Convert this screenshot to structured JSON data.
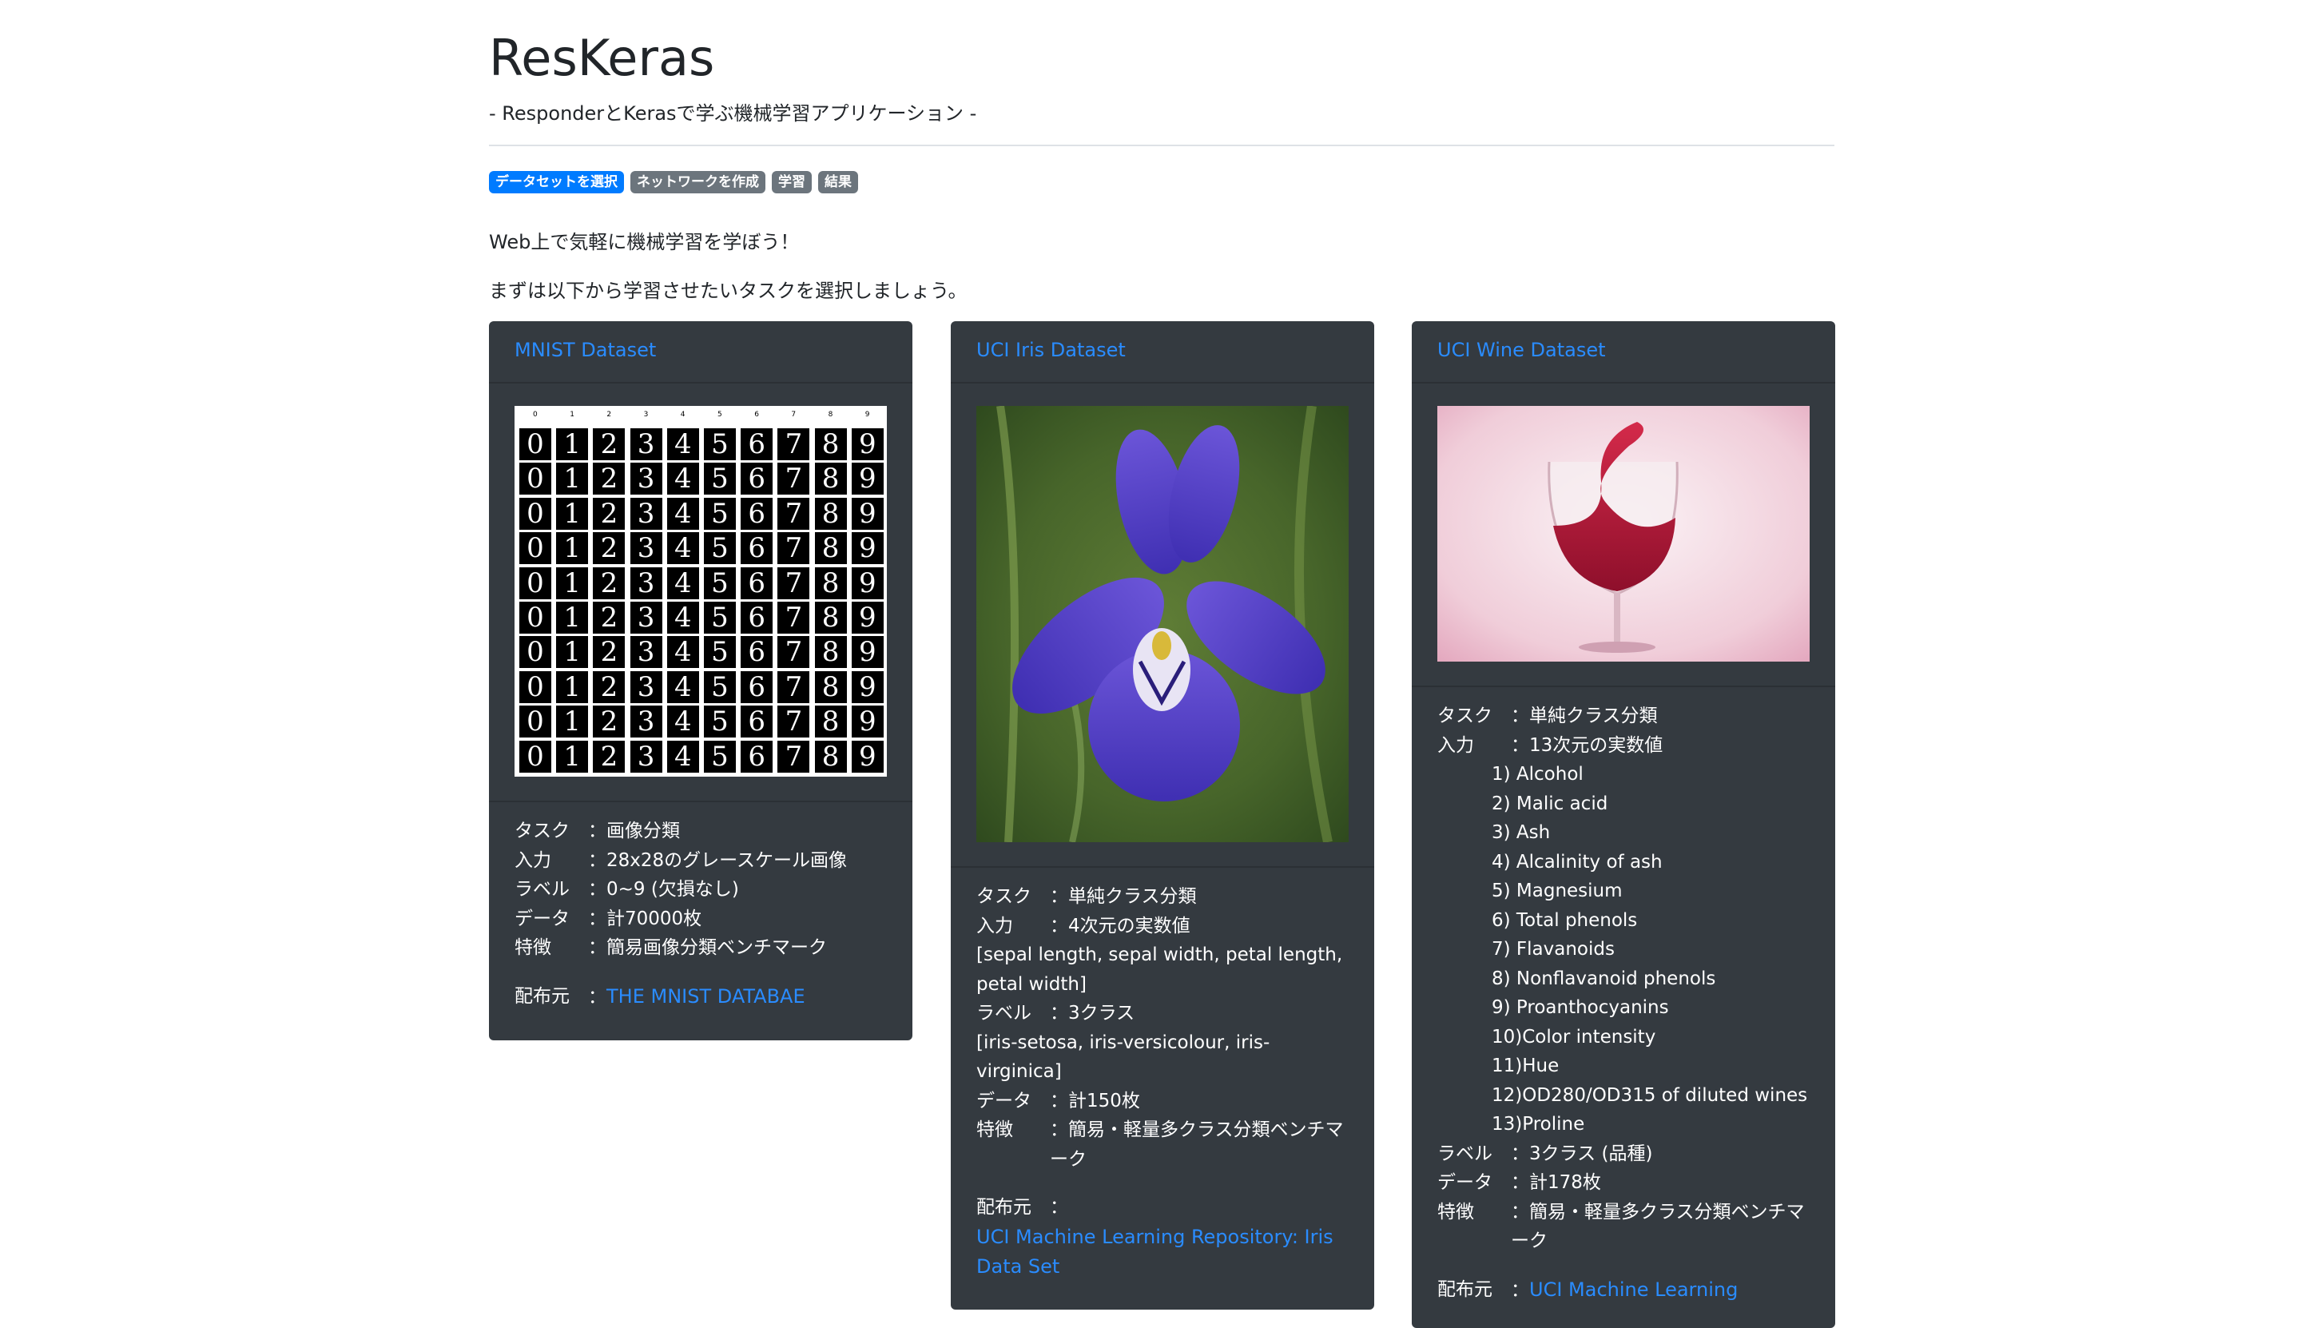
{
  "header": {
    "title": "ResKeras",
    "subtitle": "- ResponderとKerasで学ぶ機械学習アプリケーション -"
  },
  "steps": [
    "データセットを選択",
    "ネットワークを作成",
    "学習",
    "結果"
  ],
  "intro": {
    "line1": "Web上で気軽に機械学習を学ぼう！",
    "line2": "まずは以下から学習させたいタスクを選択しましょう。"
  },
  "colors": {
    "card_bg": "#343a40",
    "link": "#2a8cff",
    "badge_active": "#007bff",
    "badge": "#6c757d"
  },
  "cards": [
    {
      "name": "MNIST Dataset",
      "image_icon": "mnist-digit-grid",
      "task_label": "タスク",
      "task": "：画像分類",
      "input_label": "入力",
      "input": "：28x28のグレースケール画像",
      "label_label": "ラベル",
      "label": "：0~9 (欠損なし)",
      "data_label": "データ",
      "data": "：計70000枚",
      "feature_label": "特徴",
      "feature": "：簡易画像分類ベンチマーク",
      "source_label": "配布元",
      "source_sep": "：",
      "source": "THE MNIST DATABAE"
    },
    {
      "name": "UCI Iris Dataset",
      "image_icon": "iris-flower-photo",
      "task_label": "タスク",
      "task": "：単純クラス分類",
      "input_label": "入力",
      "input": "：4次元の実数値",
      "input_detail": "[sepal length, sepal width, petal length, petal width]",
      "label_label": "ラベル",
      "label": "：3クラス",
      "label_detail": "[iris-setosa, iris-versicolour, iris-virginica]",
      "data_label": "データ",
      "data": "：計150枚",
      "feature_label": "特徴",
      "feature": "：簡易・軽量多クラス分類ベンチマーク",
      "source_label": "配布元",
      "source_sep": "：",
      "source": "UCI Machine Learning Repository: Iris Data Set"
    },
    {
      "name": "UCI Wine Dataset",
      "image_icon": "wine-glass-photo",
      "task_label": "タスク",
      "task": "：単純クラス分類",
      "input_label": "入力",
      "input": "：13次元の実数値",
      "features": [
        "1) Alcohol",
        "2) Malic acid",
        "3) Ash",
        "4) Alcalinity of ash",
        "5) Magnesium",
        "6) Total phenols",
        "7) Flavanoids",
        "8) Nonflavanoid phenols",
        "9) Proanthocyanins",
        "10)Color intensity",
        "11)Hue",
        "12)OD280/OD315 of diluted wines",
        "13)Proline"
      ],
      "label_label": "ラベル",
      "label": "：3クラス (品種)",
      "data_label": "データ",
      "data": "：計178枚",
      "feature_label": "特徴",
      "feature": "：簡易・軽量多クラス分類ベンチマーク",
      "source_label": "配布元",
      "source_sep": "：",
      "source": "UCI Machine Learning"
    }
  ]
}
